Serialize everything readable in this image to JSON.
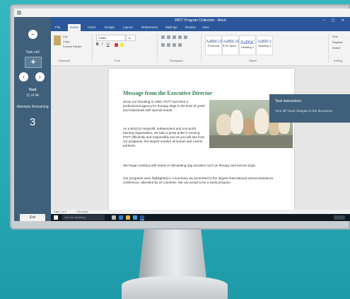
{
  "browser": {
    "url": "",
    "tab_title": ""
  },
  "window": {
    "title": "PATT Program Collection - Word",
    "controls": "– ▢ ✕"
  },
  "ribbon_tabs": [
    "File",
    "Home",
    "Insert",
    "Design",
    "Layout",
    "References",
    "Mailings",
    "Review",
    "View"
  ],
  "ribbon": {
    "font_name": "Calibri",
    "font_size": "11",
    "clipboard_items": [
      "Cut",
      "Copy",
      "Format Painter"
    ],
    "styles": [
      {
        "sample": "AaBbCcDc",
        "name": "¶ Normal"
      },
      {
        "sample": "AaBbCcDc",
        "name": "¶ No Spac..."
      },
      {
        "sample": "AaBbC",
        "name": "Heading 1"
      },
      {
        "sample": "AaBbCc",
        "name": "Heading 2"
      }
    ],
    "editing_items": [
      "Find",
      "Replace",
      "Select"
    ],
    "group_labels": [
      "Clipboard",
      "Font",
      "Paragraph",
      "Styles",
      "Editing"
    ]
  },
  "exam_panel": {
    "task_cell_label": "Task cell",
    "task_label": "Task",
    "task_position": "11 of 44",
    "attempts_label": "Attempts Remaining",
    "attempts_remaining": "3",
    "exit_label": "Exit"
  },
  "document": {
    "heading": "Message from the Executive Director",
    "intro": "Since our founding in 1994, PATT has been a professional agency for therapy dogs in the lives of youth and individuals with special needs.",
    "para2": "As a 501(c)3 nonprofit, Independent and non-profit training organization, we take a great pride in running PATT efficiently and responsibly and as you will see from our programs, the largest number of human and canine partners.",
    "para3": "We began working with teams in stimulating dog activities such as therapy and service dogs.",
    "para4": "Our programs were highlighted in a summary we presented to the largest international animal assistance conference, attended by 24 countries. We are proud to be a world program"
  },
  "task_panel": {
    "title": "Task instructions",
    "text": "Turn off Track changes in the document."
  },
  "status_bar": {
    "page": "Page 1 of 5",
    "words": "726 words"
  },
  "taskbar": {
    "search_placeholder": "Ask me anything"
  },
  "colors": {
    "exam_panel": "#3f5f7a",
    "word_blue": "#2b579a",
    "heading_green": "#2e7d4f",
    "background_teal": "#2aa9b5"
  }
}
